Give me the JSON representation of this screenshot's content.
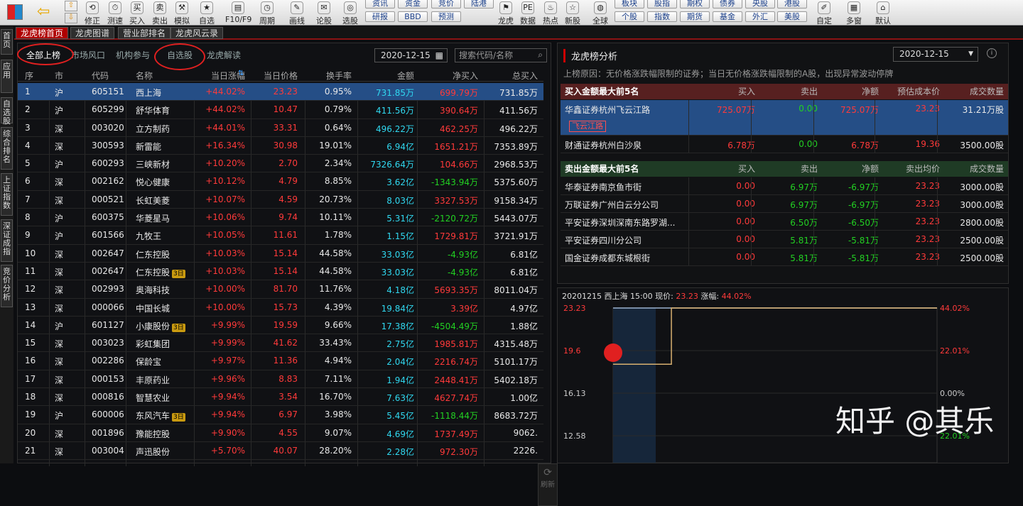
{
  "toolbar": {
    "big_items": [
      {
        "label": "修正"
      },
      {
        "label": "测速"
      },
      {
        "label": "买入"
      },
      {
        "label": "卖出"
      },
      {
        "label": "模拟"
      },
      {
        "label": "自选"
      },
      {
        "label": "F10/F9"
      },
      {
        "label": "周期"
      },
      {
        "label": "画线"
      },
      {
        "label": "论股"
      },
      {
        "label": "选股"
      },
      {
        "label": "龙虎"
      },
      {
        "label": "数据"
      },
      {
        "label": "热点"
      },
      {
        "label": "新股"
      },
      {
        "label": "全球"
      },
      {
        "label": "自定"
      },
      {
        "label": "多窗"
      },
      {
        "label": "默认"
      }
    ],
    "small_top": [
      "资讯",
      "资金",
      "竞价",
      "陆港",
      "板块",
      "股指",
      "期权",
      "债券",
      "央股",
      "港股"
    ],
    "small_bottom": [
      "研报",
      "BBD",
      "预测",
      "个股",
      "指数",
      "期货",
      "基金",
      "外汇",
      "美股"
    ]
  },
  "sidenav": [
    "首页",
    "应用",
    "自选股",
    "综合排名",
    "上证指数",
    "深证成指",
    "竞价分析"
  ],
  "tabs": [
    "龙虎榜首页",
    "龙虎图谱",
    "营业部排名",
    "龙虎风云录"
  ],
  "filters": [
    "全部上榜",
    "市场风口",
    "机构参与",
    "自选股",
    "龙虎解读"
  ],
  "date": "2020-12-15",
  "search_placeholder": "搜索代码/名称",
  "columns": [
    "序号",
    "市场",
    "代码",
    "名称",
    "当日涨幅",
    "当日价格",
    "换手率",
    "金额",
    "净买入",
    "总买入"
  ],
  "rows": [
    {
      "no": "1",
      "mkt": "沪",
      "code": "605151",
      "name": "西上海",
      "chg": "+44.02%",
      "price": "23.23",
      "turn": "0.95%",
      "amt": "731.85万",
      "net": "699.79万",
      "total": "731.85万",
      "netc": "red",
      "sel": true
    },
    {
      "no": "2",
      "mkt": "沪",
      "code": "605299",
      "name": "舒华体育",
      "chg": "+44.02%",
      "price": "10.47",
      "turn": "0.79%",
      "amt": "411.56万",
      "net": "390.64万",
      "total": "411.56万",
      "netc": "red"
    },
    {
      "no": "3",
      "mkt": "深",
      "code": "003020",
      "name": "立方制药",
      "chg": "+44.01%",
      "price": "33.31",
      "turn": "0.64%",
      "amt": "496.22万",
      "net": "462.25万",
      "total": "496.22万",
      "netc": "red"
    },
    {
      "no": "4",
      "mkt": "深",
      "code": "300593",
      "name": "新雷能",
      "chg": "+16.34%",
      "price": "30.98",
      "turn": "19.01%",
      "amt": "6.94亿",
      "net": "1651.21万",
      "total": "7353.89万",
      "netc": "red"
    },
    {
      "no": "5",
      "mkt": "沪",
      "code": "600293",
      "name": "三峡新材",
      "chg": "+10.20%",
      "price": "2.70",
      "turn": "2.34%",
      "amt": "7326.64万",
      "net": "104.66万",
      "total": "2968.53万",
      "netc": "red"
    },
    {
      "no": "6",
      "mkt": "深",
      "code": "002162",
      "name": "悦心健康",
      "chg": "+10.12%",
      "price": "4.79",
      "turn": "8.85%",
      "amt": "3.62亿",
      "net": "-1343.94万",
      "total": "5375.60万",
      "netc": "green"
    },
    {
      "no": "7",
      "mkt": "深",
      "code": "000521",
      "name": "长虹美菱",
      "chg": "+10.07%",
      "price": "4.59",
      "turn": "20.73%",
      "amt": "8.03亿",
      "net": "3327.53万",
      "total": "9158.34万",
      "netc": "red"
    },
    {
      "no": "8",
      "mkt": "沪",
      "code": "600375",
      "name": "华菱星马",
      "chg": "+10.06%",
      "price": "9.74",
      "turn": "10.11%",
      "amt": "5.31亿",
      "net": "-2120.72万",
      "total": "5443.07万",
      "netc": "green"
    },
    {
      "no": "9",
      "mkt": "沪",
      "code": "601566",
      "name": "九牧王",
      "chg": "+10.05%",
      "price": "11.61",
      "turn": "1.78%",
      "amt": "1.15亿",
      "net": "1729.81万",
      "total": "3721.91万",
      "netc": "red"
    },
    {
      "no": "10",
      "mkt": "深",
      "code": "002647",
      "name": "仁东控股",
      "chg": "+10.03%",
      "price": "15.14",
      "turn": "44.58%",
      "amt": "33.03亿",
      "net": "-4.93亿",
      "total": "6.81亿",
      "netc": "green"
    },
    {
      "no": "11",
      "mkt": "深",
      "code": "002647",
      "name": "仁东控股",
      "badge": "3日",
      "chg": "+10.03%",
      "price": "15.14",
      "turn": "44.58%",
      "amt": "33.03亿",
      "net": "-4.93亿",
      "total": "6.81亿",
      "netc": "green"
    },
    {
      "no": "12",
      "mkt": "深",
      "code": "002993",
      "name": "奥海科技",
      "chg": "+10.00%",
      "price": "81.70",
      "turn": "11.76%",
      "amt": "4.18亿",
      "net": "5693.35万",
      "total": "8011.04万",
      "netc": "red"
    },
    {
      "no": "13",
      "mkt": "深",
      "code": "000066",
      "name": "中国长城",
      "chg": "+10.00%",
      "price": "15.73",
      "turn": "4.39%",
      "amt": "19.84亿",
      "net": "3.39亿",
      "total": "4.97亿",
      "netc": "red"
    },
    {
      "no": "14",
      "mkt": "沪",
      "code": "601127",
      "name": "小康股份",
      "badge": "3日",
      "chg": "+9.99%",
      "price": "19.59",
      "turn": "9.66%",
      "amt": "17.38亿",
      "net": "-4504.49万",
      "total": "1.88亿",
      "netc": "green"
    },
    {
      "no": "15",
      "mkt": "深",
      "code": "003023",
      "name": "彩虹集团",
      "chg": "+9.99%",
      "price": "41.62",
      "turn": "33.43%",
      "amt": "2.75亿",
      "net": "1985.81万",
      "total": "4315.48万",
      "netc": "red"
    },
    {
      "no": "16",
      "mkt": "深",
      "code": "002286",
      "name": "保龄宝",
      "chg": "+9.97%",
      "price": "11.36",
      "turn": "4.94%",
      "amt": "2.04亿",
      "net": "2216.74万",
      "total": "5101.17万",
      "netc": "red"
    },
    {
      "no": "17",
      "mkt": "深",
      "code": "000153",
      "name": "丰原药业",
      "chg": "+9.96%",
      "price": "8.83",
      "turn": "7.11%",
      "amt": "1.94亿",
      "net": "2448.41万",
      "total": "5402.18万",
      "netc": "red"
    },
    {
      "no": "18",
      "mkt": "深",
      "code": "000816",
      "name": "智慧农业",
      "chg": "+9.94%",
      "price": "3.54",
      "turn": "16.70%",
      "amt": "7.63亿",
      "net": "4627.74万",
      "total": "1.00亿",
      "netc": "red"
    },
    {
      "no": "19",
      "mkt": "沪",
      "code": "600006",
      "name": "东风汽车",
      "badge": "3日",
      "chg": "+9.94%",
      "price": "6.97",
      "turn": "3.98%",
      "amt": "5.45亿",
      "net": "-1118.44万",
      "total": "8683.72万",
      "netc": "green"
    },
    {
      "no": "20",
      "mkt": "深",
      "code": "001896",
      "name": "豫能控股",
      "chg": "+9.90%",
      "price": "4.55",
      "turn": "9.07%",
      "amt": "4.69亿",
      "net": "1737.49万",
      "total": "9062.",
      "netc": "red"
    },
    {
      "no": "21",
      "mkt": "深",
      "code": "003004",
      "name": "声迅股份",
      "chg": "+5.70%",
      "price": "40.07",
      "turn": "28.20%",
      "amt": "2.28亿",
      "net": "972.30万",
      "total": "2226.",
      "netc": "red"
    }
  ],
  "refresh_label": "刷新",
  "analysis": {
    "title": "龙虎榜分析",
    "date": "2020-12-15",
    "reason": "上榜原因：无价格涨跌幅限制的证券；当日无价格涨跌幅限制的A股，出现异常波动停牌",
    "buy_header": [
      "买入金额最大前5名",
      "买入",
      "卖出",
      "净额",
      "预估成本价",
      "成交数量"
    ],
    "buy_rows": [
      {
        "name": "华鑫证券杭州飞云江路",
        "tag": "飞云江路",
        "buy": "725.07万",
        "sell": "0.00",
        "net": "725.07万",
        "price": "23.23",
        "qty": "31.21万股",
        "sel": true
      },
      {
        "name": "财通证券杭州白沙泉",
        "buy": "6.78万",
        "sell": "0.00",
        "net": "6.78万",
        "price": "19.36",
        "qty": "3500.00股"
      }
    ],
    "sell_header": [
      "卖出金额最大前5名",
      "买入",
      "卖出",
      "净额",
      "卖出均价",
      "成交数量"
    ],
    "sell_rows": [
      {
        "name": "华泰证券南京鱼市街",
        "buy": "0.00",
        "sell": "6.97万",
        "net": "-6.97万",
        "price": "23.23",
        "qty": "3000.00股"
      },
      {
        "name": "万联证券广州白云分公司",
        "buy": "0.00",
        "sell": "6.97万",
        "net": "-6.97万",
        "price": "23.23",
        "qty": "3000.00股"
      },
      {
        "name": "平安证券深圳深南东路罗湖...",
        "buy": "0.00",
        "sell": "6.50万",
        "net": "-6.50万",
        "price": "23.23",
        "qty": "2800.00股"
      },
      {
        "name": "平安证券四川分公司",
        "buy": "0.00",
        "sell": "5.81万",
        "net": "-5.81万",
        "price": "23.23",
        "qty": "2500.00股"
      },
      {
        "name": "国金证券成都东城根街",
        "buy": "0.00",
        "sell": "5.81万",
        "net": "-5.81万",
        "price": "23.23",
        "qty": "2500.00股"
      }
    ]
  },
  "chart_data": {
    "type": "line",
    "header_prefix": "20201215 西上海 15:00 现价:",
    "header_price": "23.23",
    "header_chg_label": "涨幅:",
    "header_chg": "44.02%",
    "y_left_ticks": [
      "23.23",
      "19.6",
      "16.13",
      "12.58"
    ],
    "y_right_ticks": [
      "44.02%",
      "22.01%",
      "0.00%",
      "22.01%"
    ],
    "x": [
      0,
      0.02,
      0.02,
      0.18,
      0.18,
      1
    ],
    "y": [
      19.36,
      19.36,
      19.36,
      19.36,
      23.23,
      23.23
    ],
    "ylim": [
      12.58,
      23.23
    ]
  },
  "watermark": "知乎 @其乐"
}
